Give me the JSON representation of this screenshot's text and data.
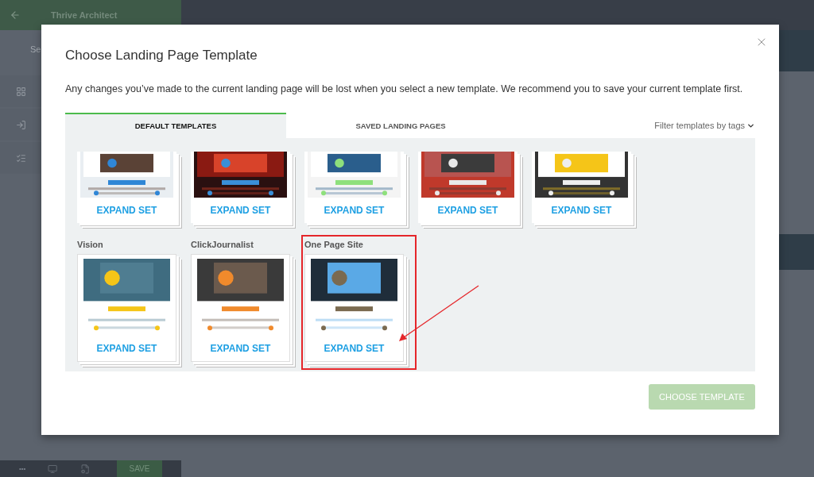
{
  "app_bar": {
    "title": "Thrive Architect",
    "search_stub": "Se"
  },
  "bottom_bar": {
    "more": "•••",
    "save": "SAVE"
  },
  "modal": {
    "title": "Choose Landing Page Template",
    "message": "Any changes you’ve made to the current landing page will be lost when you select a new template. We recommend you to save your current template first.",
    "tabs": [
      {
        "label": "DEFAULT TEMPLATES",
        "selected": true
      },
      {
        "label": "SAVED LANDING PAGES",
        "selected": false
      }
    ],
    "filter": "Filter templates by tags",
    "rows": [
      {
        "sets": [
          {
            "expand": "EXPAND SET",
            "highlighted": false,
            "kind": "picture"
          },
          {
            "expand": "EXPAND SET",
            "highlighted": false,
            "kind": "picture"
          },
          {
            "expand": "EXPAND SET",
            "highlighted": false,
            "kind": "picture"
          },
          {
            "expand": "EXPAND SET",
            "highlighted": false,
            "kind": "picture"
          },
          {
            "expand": "EXPAND SET",
            "highlighted": false,
            "kind": "picture"
          }
        ]
      },
      {
        "sets": [
          {
            "name": "Vision",
            "expand": "EXPAND SET",
            "highlighted": false,
            "kind": "picture"
          },
          {
            "name": "ClickJournalist",
            "expand": "EXPAND SET",
            "highlighted": false,
            "kind": "picture"
          },
          {
            "name": "One Page Site",
            "expand": "EXPAND SET",
            "highlighted": true,
            "kind": "picture"
          }
        ]
      }
    ],
    "choose_button": {
      "label": "CHOOSE TEMPLATE",
      "disabled": true
    }
  }
}
